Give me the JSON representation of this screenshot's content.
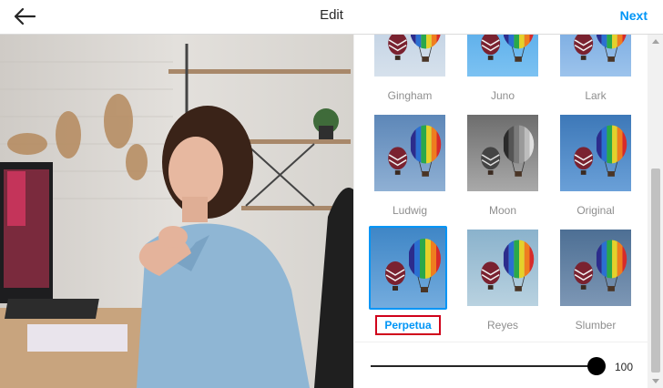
{
  "header": {
    "title": "Edit",
    "next_label": "Next",
    "accent_color": "#0095f6"
  },
  "icons": {
    "back": "arrow-left-icon"
  },
  "filters": [
    {
      "label": "Gingham"
    },
    {
      "label": "Juno"
    },
    {
      "label": "Lark"
    },
    {
      "label": "Ludwig"
    },
    {
      "label": "Moon"
    },
    {
      "label": "Original"
    },
    {
      "label": "Perpetua",
      "selected": true
    },
    {
      "label": "Reyes"
    },
    {
      "label": "Slumber"
    }
  ],
  "slider": {
    "value_label": "100",
    "value": 100
  }
}
